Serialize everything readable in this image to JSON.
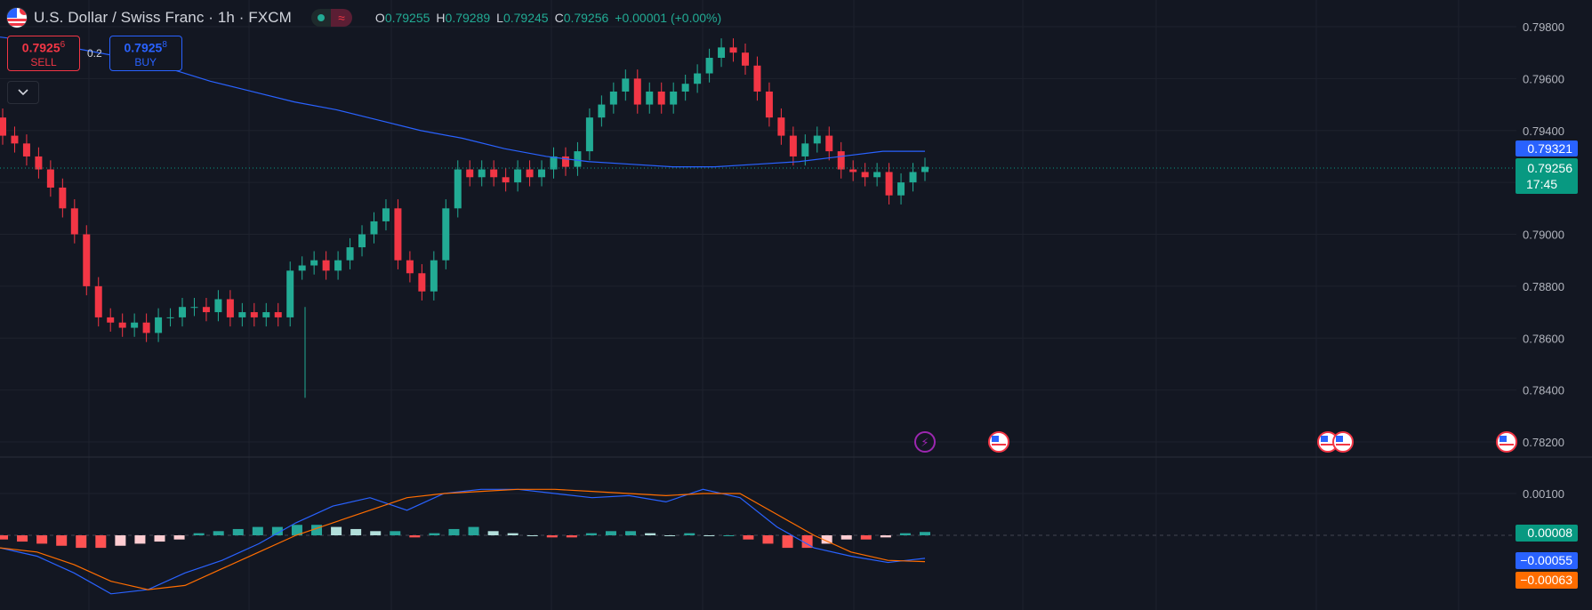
{
  "header": {
    "title": "U.S. Dollar / Swiss Franc · 1h · FXCM",
    "ohlc": {
      "o_label": "O",
      "o": "0.79255",
      "h_label": "H",
      "h": "0.79289",
      "l_label": "L",
      "l": "0.79245",
      "c_label": "C",
      "c": "0.79256",
      "change": "+0.00001 (+0.00%)"
    },
    "toggle_icon": "≈"
  },
  "trade": {
    "sell_price": "0.7925",
    "sell_pip": "6",
    "sell_label": "SELL",
    "spread": "0.2",
    "buy_price": "0.7925",
    "buy_pip": "8",
    "buy_label": "BUY"
  },
  "collapse_icon": "chevron-down-icon",
  "tags": {
    "ema": "0.79321",
    "price": "0.79256",
    "countdown": "17:45",
    "hist": "0.00008",
    "macd": "−0.00055",
    "signal": "−0.00063"
  },
  "colors": {
    "up": "#22ab94",
    "down": "#f23645",
    "ema": "#2962ff",
    "macd": "#2962ff",
    "signal": "#ff6d00",
    "grid": "#1e222d"
  },
  "chart_data": [
    {
      "type": "candlestick",
      "ylim": [
        0.7805,
        0.7988
      ],
      "y_ticks": [
        "0.79800",
        "0.79600",
        "0.79400",
        "0.79200",
        "0.79000",
        "0.78800",
        "0.78600",
        "0.78400",
        "0.78200"
      ],
      "y_tick_values": [
        0.798,
        0.796,
        0.794,
        0.792,
        0.79,
        0.788,
        0.786,
        0.784,
        0.782
      ],
      "series": [
        {
          "close": [
            0.7938,
            0.7935,
            0.793,
            0.7925,
            0.7918,
            0.791,
            0.79,
            0.788,
            0.7868,
            0.7866,
            0.7864,
            0.7866,
            0.7862,
            0.7868,
            0.7868,
            0.7872,
            0.7872,
            0.787,
            0.7875,
            0.7868,
            0.787,
            0.7868,
            0.787,
            0.7868,
            0.7886,
            0.7888,
            0.789,
            0.7886,
            0.789,
            0.7895,
            0.79,
            0.7905,
            0.791,
            0.789,
            0.7885,
            0.7878,
            0.789,
            0.791,
            0.7925,
            0.7922,
            0.7925,
            0.7922,
            0.792,
            0.7925,
            0.7922,
            0.7925,
            0.793,
            0.7926,
            0.7932,
            0.7945,
            0.795,
            0.7955,
            0.796,
            0.795,
            0.7955,
            0.795,
            0.7955,
            0.7958,
            0.7962,
            0.7968,
            0.7972,
            0.797,
            0.7965,
            0.7955,
            0.7945,
            0.7938,
            0.793,
            0.7935,
            0.7938,
            0.7932,
            0.7925,
            0.7924,
            0.7922,
            0.7924,
            0.7915,
            0.792,
            0.7924,
            0.7926
          ],
          "name": ""
        }
      ],
      "ema_series": [
        0.7976,
        0.7974,
        0.7971,
        0.7968,
        0.7964,
        0.7959,
        0.7955,
        0.7951,
        0.7948,
        0.7944,
        0.794,
        0.7937,
        0.7933,
        0.793,
        0.7928,
        0.7927,
        0.7926,
        0.7926,
        0.7927,
        0.7928,
        0.793,
        0.7932,
        0.7932
      ]
    },
    {
      "type": "macd",
      "ylim": [
        -0.0018,
        0.0014
      ],
      "y_ticks": [
        "0.00100"
      ],
      "y_tick_values": [
        0.001
      ],
      "histogram": [
        -0.0001,
        -0.00015,
        -0.0002,
        -0.00025,
        -0.0003,
        -0.0003,
        -0.00025,
        -0.0002,
        -0.00015,
        -0.0001,
        5e-05,
        0.0001,
        0.00015,
        0.0002,
        0.0002,
        0.00025,
        0.00025,
        0.0002,
        0.00015,
        0.0001,
        0.0001,
        -5e-05,
        5e-05,
        0.00015,
        0.0002,
        0.0001,
        5e-05,
        0.0,
        -5e-05,
        -5e-05,
        5e-05,
        0.0001,
        0.0001,
        5e-05,
        0.0,
        5e-05,
        0.0,
        0.0,
        -0.0001,
        -0.0002,
        -0.0003,
        -0.0003,
        -0.0002,
        -0.0001,
        -0.0001,
        -5e-05,
        5e-05,
        8e-05
      ],
      "macd_line": [
        -0.0003,
        -0.0005,
        -0.0009,
        -0.0014,
        -0.0013,
        -0.0009,
        -0.0006,
        -0.0002,
        0.0003,
        0.0007,
        0.0009,
        0.0006,
        0.001,
        0.0011,
        0.0011,
        0.001,
        0.0009,
        0.00095,
        0.0008,
        0.0011,
        0.0009,
        0.0002,
        -0.0003,
        -0.0005,
        -0.00065,
        -0.00055
      ],
      "signal_line": [
        -0.0003,
        -0.0004,
        -0.0007,
        -0.0011,
        -0.0013,
        -0.0012,
        -0.0008,
        -0.0004,
        0.0,
        0.0003,
        0.0006,
        0.0009,
        0.001,
        0.00105,
        0.0011,
        0.0011,
        0.00105,
        0.001,
        0.00095,
        0.001,
        0.001,
        0.0005,
        0.0,
        -0.0004,
        -0.0006,
        -0.00063
      ]
    }
  ]
}
